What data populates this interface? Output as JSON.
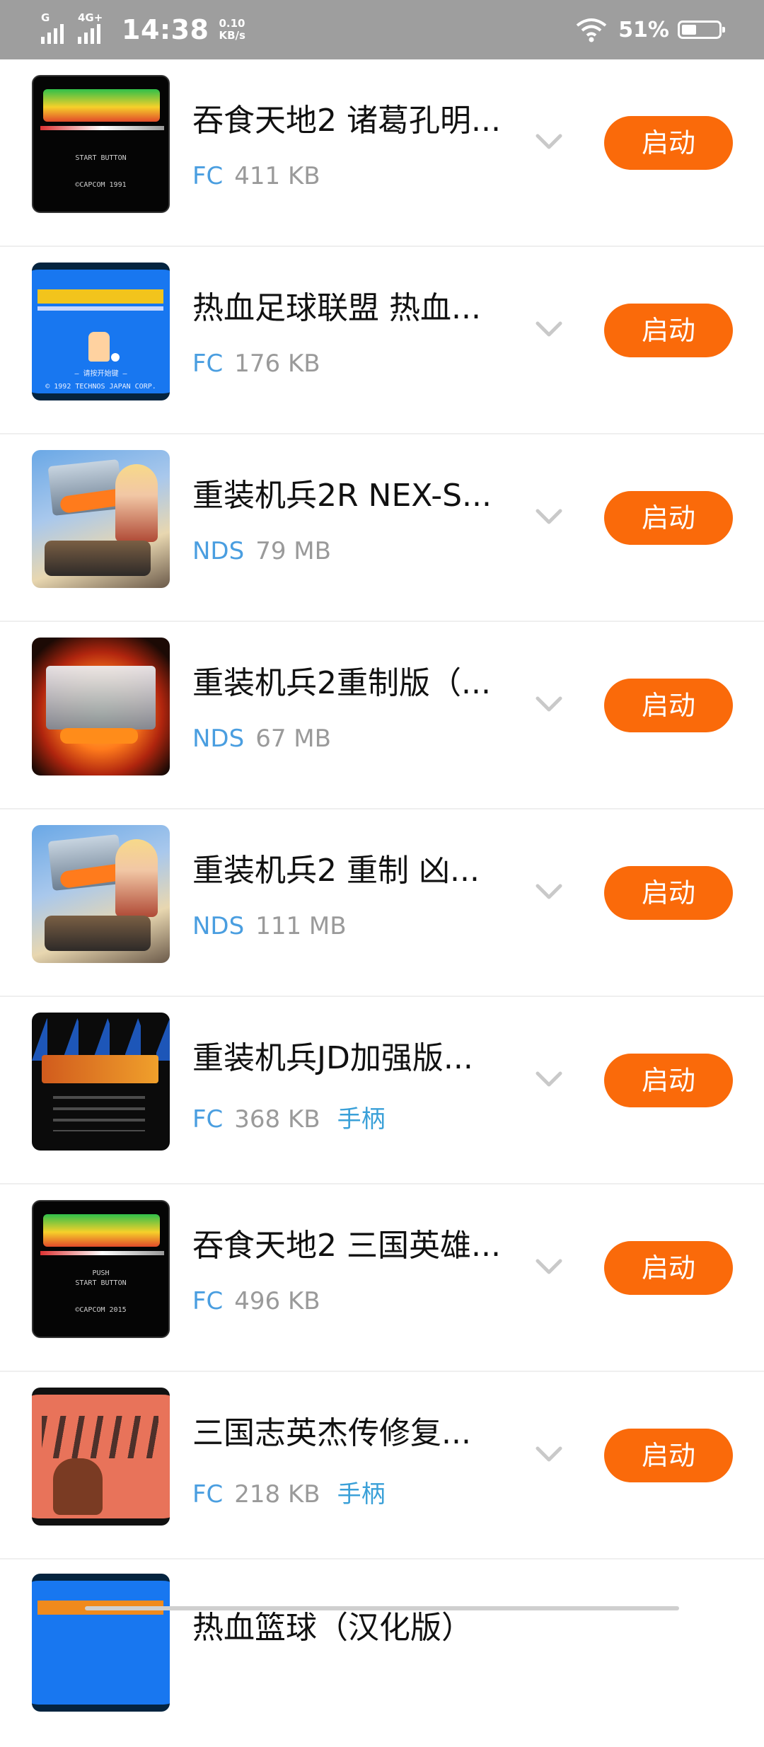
{
  "status_bar": {
    "time": "14:38",
    "net_tag": "G",
    "net_tag2": "4G+",
    "speed_value": "0.10",
    "speed_unit": "KB/s",
    "battery": "51%"
  },
  "button_label": "启动",
  "games": [
    {
      "title": "吞食天地2 诸葛孔明...",
      "platform": "FC",
      "size": "411 KB",
      "controller": "",
      "art": "black"
    },
    {
      "title": "热血足球联盟 热血...",
      "platform": "FC",
      "size": "176 KB",
      "controller": "",
      "art": "blue"
    },
    {
      "title": "重装机兵2R NEX-S...",
      "platform": "NDS",
      "size": "79 MB",
      "controller": "",
      "art": "mm"
    },
    {
      "title": "重装机兵2重制版（...",
      "platform": "NDS",
      "size": "67 MB",
      "controller": "",
      "art": "fire"
    },
    {
      "title": "重装机兵2 重制 凶...",
      "platform": "NDS",
      "size": "111 MB",
      "controller": "",
      "art": "mm"
    },
    {
      "title": "重装机兵JD加强版...",
      "platform": "FC",
      "size": "368 KB",
      "controller": "手柄",
      "art": "dark"
    },
    {
      "title": "吞食天地2 三国英雄...",
      "platform": "FC",
      "size": "496 KB",
      "controller": "",
      "art": "black"
    },
    {
      "title": "三国志英杰传修复...",
      "platform": "FC",
      "size": "218 KB",
      "controller": "手柄",
      "art": "salmon"
    },
    {
      "title": "热血篮球（汉化版）",
      "platform": "",
      "size": "",
      "controller": "",
      "art": "blue"
    }
  ],
  "icons": {
    "expand": "chevron-down-icon",
    "wifi": "wifi-icon",
    "battery": "battery-icon",
    "signal": "signal-icon"
  },
  "colors": {
    "accent": "#fa6a0a",
    "platform": "#4a9ee0",
    "status_bar": "#9e9e9e"
  }
}
